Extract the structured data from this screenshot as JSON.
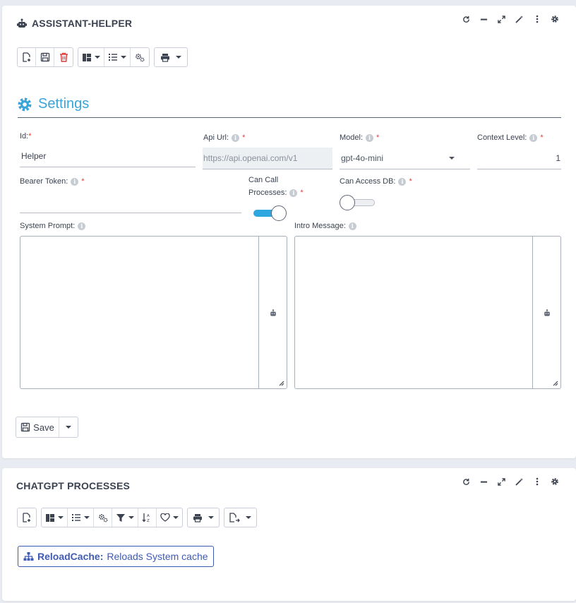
{
  "card1": {
    "title": "ASSISTANT-HELPER",
    "title_icon": "robot-icon",
    "window_controls": [
      "refresh-icon",
      "minimize-icon",
      "expand-icon",
      "magic-wand-icon",
      "more-vertical-icon",
      "gear-icon"
    ],
    "toolbar_icons": [
      "new-document-icon",
      "save-icon",
      "delete-icon",
      "layout-icon",
      "list-icon",
      "cogs-icon",
      "print-icon"
    ]
  },
  "settings": {
    "heading": "Settings",
    "id": {
      "label": "Id:",
      "value": "Helper"
    },
    "api_url": {
      "label": "Api Url:",
      "value": "https://api.openai.com/v1"
    },
    "model": {
      "label": "Model:",
      "value": "gpt-4o-mini"
    },
    "context_level": {
      "label": "Context Level:",
      "value": "1"
    },
    "bearer_token": {
      "label": "Bearer Token:",
      "value": ""
    },
    "can_call_processes": {
      "label_line1": "Can Call",
      "label_line2": "Processes:",
      "on": true
    },
    "can_access_db": {
      "label": "Can Access DB:",
      "on": false
    },
    "system_prompt": {
      "label": "System Prompt:",
      "value": ""
    },
    "intro_message": {
      "label": "Intro Message:",
      "value": ""
    },
    "required_mark": "*",
    "info_glyph": "i"
  },
  "save_button": {
    "label": "Save"
  },
  "card2": {
    "title": "CHATGPT PROCESSES",
    "process": {
      "name": "ReloadCache:",
      "description": "Reloads System cache"
    }
  },
  "colors": {
    "accent": "#3ba4d8",
    "toggle_on": "#2ea7e0",
    "delete_red": "#d93a3a",
    "required": "#e23c3c",
    "link_blue": "#3f5bb5"
  }
}
